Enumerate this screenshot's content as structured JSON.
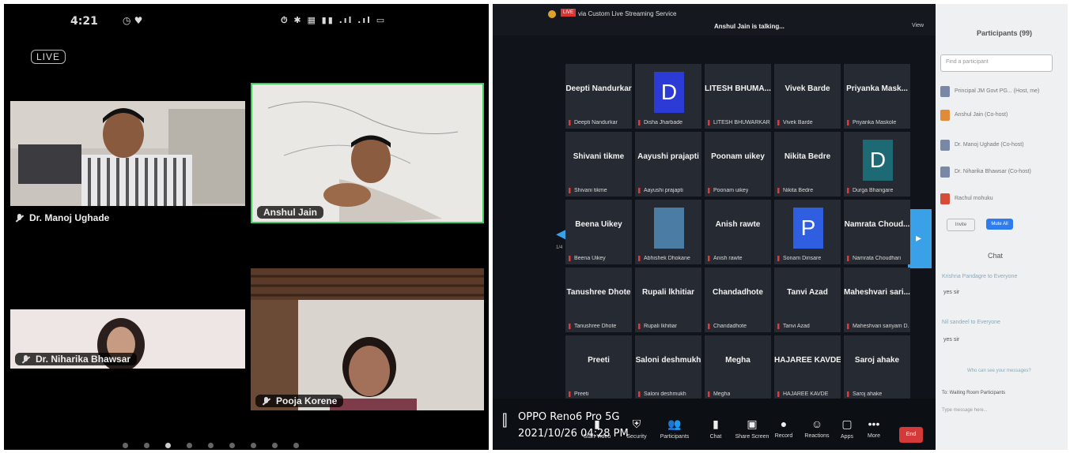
{
  "phone": {
    "time": "4:21",
    "status_icons": "⏱ ✱ ▦ ▮▮ .ıl .ıl ▭",
    "live_label": "LIVE",
    "tiles": [
      {
        "name": "Dr. Manoj Ughade"
      },
      {
        "name": "Anshul Jain"
      },
      {
        "name": "Dr. Niharika Bhawsar"
      },
      {
        "name": "Pooja Korene"
      }
    ]
  },
  "zoom": {
    "top_title": "via Custom Live Streaming Service",
    "talking": "Anshul Jain is talking...",
    "view_label": "View",
    "page_indicator": "1/4",
    "grid": [
      {
        "name": "Deepti Nandurkar",
        "label": "Deepti Nandurkar"
      },
      {
        "name": "",
        "label": "Disha Jharbade",
        "avatar": "D",
        "color": "#2d3bd6"
      },
      {
        "name": "LITESH BHUMA...",
        "label": "LITESH BHUWARKAR"
      },
      {
        "name": "Vivek Barde",
        "label": "Vivek Barde"
      },
      {
        "name": "Priyanka Mask...",
        "label": "Priyanka Maskole"
      },
      {
        "name": "Shivani tikme",
        "label": "Shivani tikme"
      },
      {
        "name": "Aayushi prajapti",
        "label": "Aayushi prajapti"
      },
      {
        "name": "Poonam uikey",
        "label": "Poonam uikey"
      },
      {
        "name": "Nikita Bedre",
        "label": "Nikita Bedre"
      },
      {
        "name": "",
        "label": "Durga Bhangare",
        "avatar": "D",
        "color": "#1d6a74"
      },
      {
        "name": "Beena Uikey",
        "label": "Beena Uikey"
      },
      {
        "name": "",
        "label": "Abhishek Dhokane",
        "avatar": "",
        "color": "#4a7ca4"
      },
      {
        "name": "Anish rawte",
        "label": "Anish rawte"
      },
      {
        "name": "",
        "label": "Sonam Dinsare",
        "avatar": "P",
        "color": "#2f5fe0"
      },
      {
        "name": "Namrata Choud...",
        "label": "Namrata Choudhari"
      },
      {
        "name": "Tanushree Dhote",
        "label": "Tanushree Dhote"
      },
      {
        "name": "Rupali lkhitiar",
        "label": "Rupali lkhitiar"
      },
      {
        "name": "Chandadhote",
        "label": "Chandadhote"
      },
      {
        "name": "Tanvi Azad",
        "label": "Tanvi Azad"
      },
      {
        "name": "Maheshvari sari...",
        "label": "Maheshvari sariyam D..."
      },
      {
        "name": "Preeti",
        "label": "Preeti"
      },
      {
        "name": "Saloni deshmukh",
        "label": "Saloni deshmukh"
      },
      {
        "name": "Megha",
        "label": "Megha"
      },
      {
        "name": "HAJAREE KAVDE",
        "label": "HAJAREE KAVDE"
      },
      {
        "name": "Saroj ahake",
        "label": "Saroj ahake"
      }
    ],
    "sidebar": {
      "title": "Participants (99)",
      "search_placeholder": "Find a participant",
      "participants": [
        "Principal JM Govt PG... (Host, me)",
        "Anshul Jain (Co-host)",
        "Dr. Manoj Ughade (Co-host)",
        "Dr. Niharika Bhawsar (Co-host)",
        "Rachul mohuku"
      ],
      "invite": "Invite",
      "mute_all": "Mute All",
      "chat_title": "Chat",
      "chat_messages": [
        "Krishna Pandagre to Everyone",
        "yes sir",
        "Nil sandeel to Everyone",
        "yes sir"
      ],
      "who_can_see": "Who can see your messages?",
      "to_label": "To: Waiting Room Participants",
      "type_placeholder": "Type message here..."
    },
    "toolbar": [
      {
        "glyph": "▮",
        "label": "Start Video"
      },
      {
        "glyph": "⛨",
        "label": "Security"
      },
      {
        "glyph": "👥",
        "label": "Participants"
      },
      {
        "glyph": "▮",
        "label": "Chat"
      },
      {
        "glyph": "▣",
        "label": "Share Screen"
      },
      {
        "glyph": "●",
        "label": "Record"
      },
      {
        "glyph": "☺",
        "label": "Reactions"
      },
      {
        "glyph": "▢",
        "label": "Apps"
      },
      {
        "glyph": "•••",
        "label": "More"
      }
    ],
    "end_label": "End",
    "stamp_device": "OPPO Reno6 Pro 5G",
    "stamp_datetime": "2021/10/26 04:28 PM"
  }
}
